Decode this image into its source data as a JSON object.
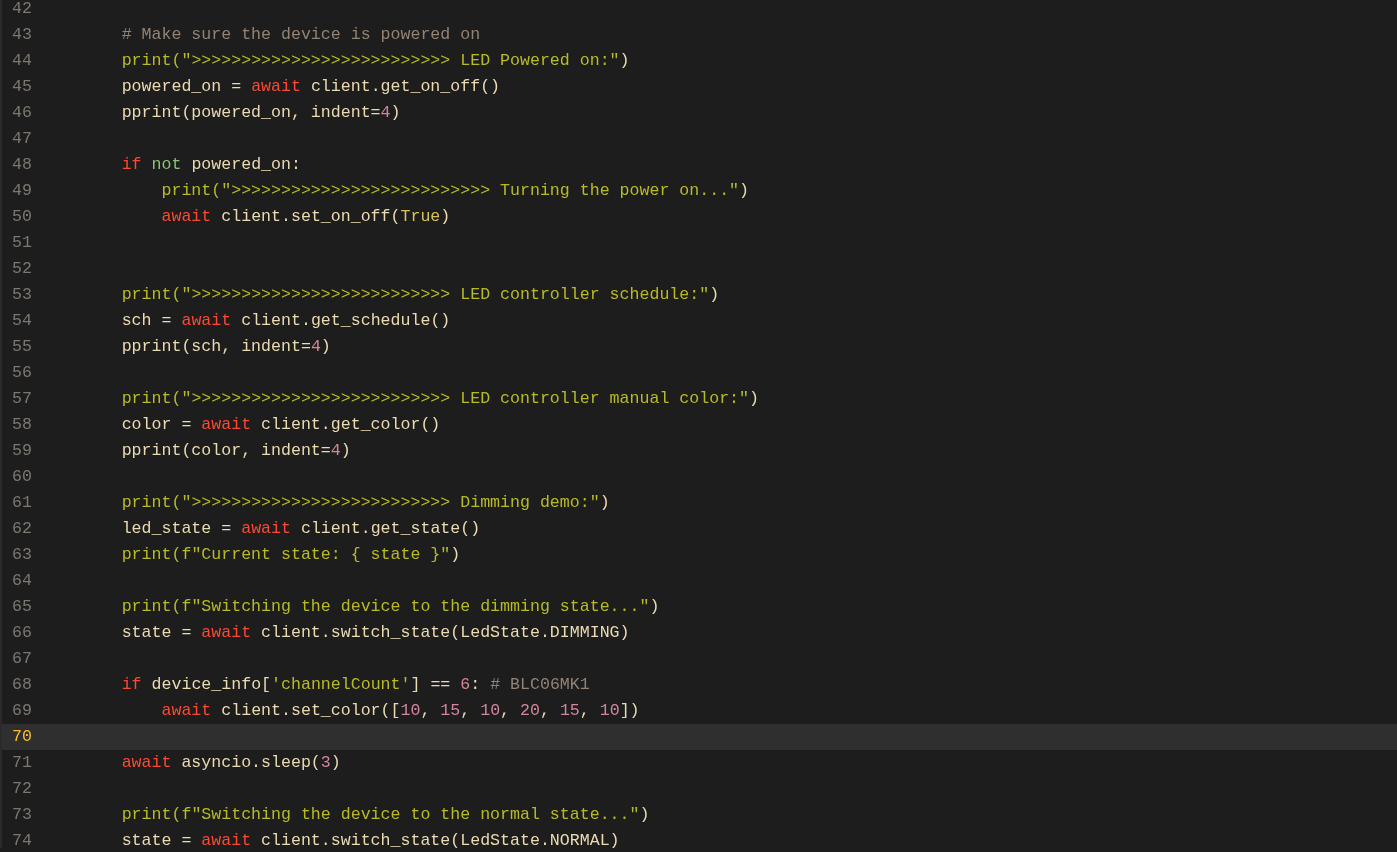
{
  "editor": {
    "lines": [
      {
        "number": "42",
        "current": false
      },
      {
        "number": "43",
        "current": false,
        "tokens": [
          {
            "text": "        # Make sure the device is powered on",
            "kind": "comment"
          }
        ]
      },
      {
        "number": "44",
        "current": false,
        "tokens": [
          {
            "text": "        print(",
            "kind": "builtin"
          },
          {
            "text": "\">>>>>>>>>>>>>>>>>>>>>>>>>> LED Powered on:\"",
            "kind": "string"
          },
          {
            "text": ")",
            "kind": "plain"
          }
        ]
      },
      {
        "number": "45",
        "current": false,
        "tokens": [
          {
            "text": "        powered_on = ",
            "kind": "plain"
          },
          {
            "text": "await",
            "kind": "keyword"
          },
          {
            "text": " client.get_on_off()",
            "kind": "plain"
          }
        ]
      },
      {
        "number": "46",
        "current": false,
        "tokens": [
          {
            "text": "        pprint(powered_on, indent=",
            "kind": "plain"
          },
          {
            "text": "4",
            "kind": "number"
          },
          {
            "text": ")",
            "kind": "plain"
          }
        ]
      },
      {
        "number": "47",
        "current": false
      },
      {
        "number": "48",
        "current": false,
        "tokens": [
          {
            "text": "        if",
            "kind": "keyword"
          },
          {
            "text": " not",
            "kind": "operator"
          },
          {
            "text": " powered_on:",
            "kind": "plain"
          }
        ]
      },
      {
        "number": "49",
        "current": false,
        "tokens": [
          {
            "text": "            print(",
            "kind": "builtin"
          },
          {
            "text": "\">>>>>>>>>>>>>>>>>>>>>>>>>> Turning the power on...\"",
            "kind": "string"
          },
          {
            "text": ")",
            "kind": "plain"
          }
        ]
      },
      {
        "number": "50",
        "current": false,
        "tokens": [
          {
            "text": "            await",
            "kind": "keyword"
          },
          {
            "text": " client.set_on_off(",
            "kind": "plain"
          },
          {
            "text": "True",
            "kind": "constant"
          },
          {
            "text": ")",
            "kind": "plain"
          }
        ]
      },
      {
        "number": "51",
        "current": false
      },
      {
        "number": "52",
        "current": false
      },
      {
        "number": "53",
        "current": false,
        "tokens": [
          {
            "text": "        print(",
            "kind": "builtin"
          },
          {
            "text": "\">>>>>>>>>>>>>>>>>>>>>>>>>> LED controller schedule:\"",
            "kind": "string"
          },
          {
            "text": ")",
            "kind": "plain"
          }
        ]
      },
      {
        "number": "54",
        "current": false,
        "tokens": [
          {
            "text": "        sch = ",
            "kind": "plain"
          },
          {
            "text": "await",
            "kind": "keyword"
          },
          {
            "text": " client.get_schedule()",
            "kind": "plain"
          }
        ]
      },
      {
        "number": "55",
        "current": false,
        "tokens": [
          {
            "text": "        pprint(sch, indent=",
            "kind": "plain"
          },
          {
            "text": "4",
            "kind": "number"
          },
          {
            "text": ")",
            "kind": "plain"
          }
        ]
      },
      {
        "number": "56",
        "current": false
      },
      {
        "number": "57",
        "current": false,
        "tokens": [
          {
            "text": "        print(",
            "kind": "builtin"
          },
          {
            "text": "\">>>>>>>>>>>>>>>>>>>>>>>>>> LED controller manual color:\"",
            "kind": "string"
          },
          {
            "text": ")",
            "kind": "plain"
          }
        ]
      },
      {
        "number": "58",
        "current": false,
        "tokens": [
          {
            "text": "        color = ",
            "kind": "plain"
          },
          {
            "text": "await",
            "kind": "keyword"
          },
          {
            "text": " client.get_color()",
            "kind": "plain"
          }
        ]
      },
      {
        "number": "59",
        "current": false,
        "tokens": [
          {
            "text": "        pprint(color, indent=",
            "kind": "plain"
          },
          {
            "text": "4",
            "kind": "number"
          },
          {
            "text": ")",
            "kind": "plain"
          }
        ]
      },
      {
        "number": "60",
        "current": false
      },
      {
        "number": "61",
        "current": false,
        "tokens": [
          {
            "text": "        print(",
            "kind": "builtin"
          },
          {
            "text": "\">>>>>>>>>>>>>>>>>>>>>>>>>> Dimming demo:\"",
            "kind": "string"
          },
          {
            "text": ")",
            "kind": "plain"
          }
        ]
      },
      {
        "number": "62",
        "current": false,
        "tokens": [
          {
            "text": "        led_state = ",
            "kind": "plain"
          },
          {
            "text": "await",
            "kind": "keyword"
          },
          {
            "text": " client.get_state()",
            "kind": "plain"
          }
        ]
      },
      {
        "number": "63",
        "current": false,
        "tokens": [
          {
            "text": "        print(f",
            "kind": "builtin"
          },
          {
            "text": "\"Current state: { state }\"",
            "kind": "string"
          },
          {
            "text": ")",
            "kind": "plain"
          }
        ]
      },
      {
        "number": "64",
        "current": false
      },
      {
        "number": "65",
        "current": false,
        "tokens": [
          {
            "text": "        print(f",
            "kind": "builtin"
          },
          {
            "text": "\"Switching the device to the dimming state...\"",
            "kind": "string"
          },
          {
            "text": ")",
            "kind": "plain"
          }
        ]
      },
      {
        "number": "66",
        "current": false,
        "tokens": [
          {
            "text": "        state = ",
            "kind": "plain"
          },
          {
            "text": "await",
            "kind": "keyword"
          },
          {
            "text": " client.switch_state(LedState.DIMMING)",
            "kind": "plain"
          }
        ]
      },
      {
        "number": "67",
        "current": false
      },
      {
        "number": "68",
        "current": false,
        "tokens": [
          {
            "text": "        if",
            "kind": "keyword"
          },
          {
            "text": " device_info[",
            "kind": "plain"
          },
          {
            "text": "'channelCount'",
            "kind": "string"
          },
          {
            "text": "] == ",
            "kind": "plain"
          },
          {
            "text": "6",
            "kind": "number"
          },
          {
            "text": ": ",
            "kind": "plain"
          },
          {
            "text": "# BLC06MK1",
            "kind": "comment"
          }
        ]
      },
      {
        "number": "69",
        "current": false,
        "tokens": [
          {
            "text": "            await",
            "kind": "keyword"
          },
          {
            "text": " client.set_color([",
            "kind": "plain"
          },
          {
            "text": "10",
            "kind": "number"
          },
          {
            "text": ", ",
            "kind": "plain"
          },
          {
            "text": "15",
            "kind": "number"
          },
          {
            "text": ", ",
            "kind": "plain"
          },
          {
            "text": "10",
            "kind": "number"
          },
          {
            "text": ", ",
            "kind": "plain"
          },
          {
            "text": "20",
            "kind": "number"
          },
          {
            "text": ", ",
            "kind": "plain"
          },
          {
            "text": "15",
            "kind": "number"
          },
          {
            "text": ", ",
            "kind": "plain"
          },
          {
            "text": "10",
            "kind": "number"
          },
          {
            "text": "])",
            "kind": "plain"
          }
        ]
      },
      {
        "number": "70",
        "current": true
      },
      {
        "number": "71",
        "current": false,
        "tokens": [
          {
            "text": "        await",
            "kind": "keyword"
          },
          {
            "text": " asyncio.sleep(",
            "kind": "plain"
          },
          {
            "text": "3",
            "kind": "number"
          },
          {
            "text": ")",
            "kind": "plain"
          }
        ]
      },
      {
        "number": "72",
        "current": false
      },
      {
        "number": "73",
        "current": false,
        "tokens": [
          {
            "text": "        print(f",
            "kind": "builtin"
          },
          {
            "text": "\"Switching the device to the normal state...\"",
            "kind": "string"
          },
          {
            "text": ")",
            "kind": "plain"
          }
        ]
      },
      {
        "number": "74",
        "current": false,
        "tokens": [
          {
            "text": "        state = ",
            "kind": "plain"
          },
          {
            "text": "await",
            "kind": "keyword"
          },
          {
            "text": " client.switch_state(LedState.NORMAL)",
            "kind": "plain"
          }
        ]
      }
    ]
  }
}
